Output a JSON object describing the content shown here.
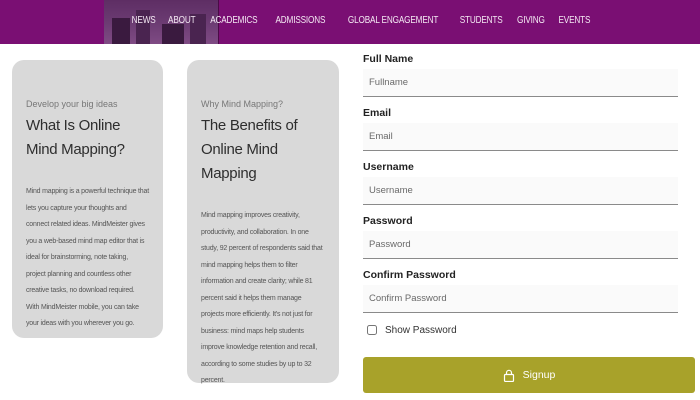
{
  "nav": {
    "items": [
      "NEWS",
      "ABOUT",
      "ACADEMICS",
      "ADMISSIONS",
      "GLOBAL ENGAGEMENT",
      "STUDENTS",
      "GIVING",
      "EVENTS"
    ]
  },
  "cards": [
    {
      "kicker": "Develop your big ideas",
      "title": "What Is Online Mind Mapping?",
      "body": "Mind mapping is a powerful technique that lets you capture your thoughts and connect related ideas. MindMeister gives you a web-based mind map editor that is ideal for brainstorming, note taking, project planning and countless other creative tasks, no download required. With MindMeister mobile, you can take your ideas with you wherever you go."
    },
    {
      "kicker": "Why Mind Mapping?",
      "title": "The Benefits of Online Mind Mapping",
      "body": "Mind mapping improves creativity, productivity, and collaboration. In one study, 92 percent of respondents said that mind mapping helps them to filter information and create clarity; while 81 percent said it helps them manage projects more efficiently. It's not just for business: mind maps help students improve knowledge retention and recall, according to some studies by up to 32 percent."
    }
  ],
  "form": {
    "fullname": {
      "label": "Full Name",
      "placeholder": "Fullname"
    },
    "email": {
      "label": "Email",
      "placeholder": "Email"
    },
    "username": {
      "label": "Username",
      "placeholder": "Username"
    },
    "password": {
      "label": "Password",
      "placeholder": "Password"
    },
    "confirm": {
      "label": "Confirm Password",
      "placeholder": "Confirm Password"
    },
    "show_password": "Show Password",
    "signup": "Signup"
  },
  "colors": {
    "header": "#7a0f73",
    "card": "#d9d9d9",
    "signup_button": "#a8a22a"
  },
  "icons": {
    "signup": "lock-icon"
  }
}
